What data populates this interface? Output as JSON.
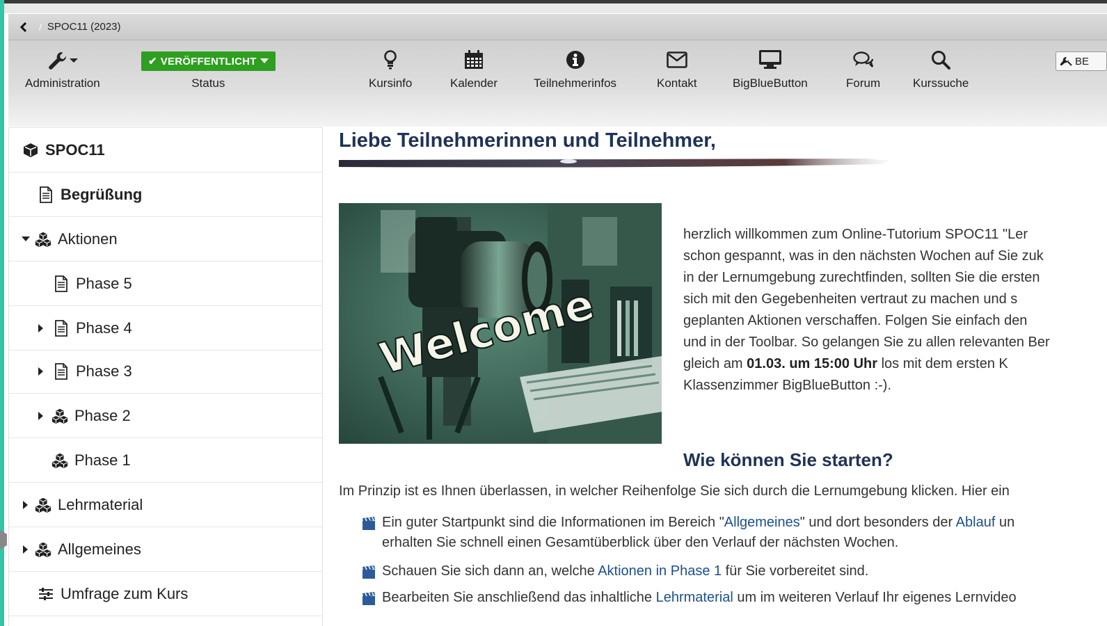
{
  "breadcrumb": {
    "back_label": "<",
    "course": "SPOC11 (2023)"
  },
  "toolbar": {
    "administration": "Administration",
    "status_badge": "VERÖFFENTLICHT",
    "status_label": "Status",
    "kursinfo": "Kursinfo",
    "kalender": "Kalender",
    "teilnehmerinfos": "Teilnehmerinfos",
    "kontakt": "Kontakt",
    "bigbluebutton": "BigBlueButton",
    "forum": "Forum",
    "kurssuche": "Kurssuche",
    "edit_label": "BE"
  },
  "sidebar": {
    "items": [
      {
        "label": "SPOC11",
        "icon": "cube-icon"
      },
      {
        "label": "Begrüßung",
        "icon": "document-icon"
      },
      {
        "label": "Aktionen",
        "icon": "cubes-icon",
        "expanded": true
      },
      {
        "label": "Phase 5",
        "icon": "document-icon"
      },
      {
        "label": "Phase 4",
        "icon": "document-icon"
      },
      {
        "label": "Phase 3",
        "icon": "document-icon"
      },
      {
        "label": "Phase 2",
        "icon": "cubes-icon"
      },
      {
        "label": "Phase 1",
        "icon": "cubes-icon"
      },
      {
        "label": "Lehrmaterial",
        "icon": "cubes-icon"
      },
      {
        "label": "Allgemeines",
        "icon": "cubes-icon"
      },
      {
        "label": "Umfrage zum Kurs",
        "icon": "survey-icon"
      }
    ]
  },
  "main": {
    "title": "Liebe Teilnehmerinnen und Teilnehmer,",
    "image_text": "Welcome",
    "intro_lines": [
      "herzlich willkommen zum Online-Tutorium SPOC11 \"Ler",
      "schon gespannt, was in den nächsten Wochen auf Sie zuk",
      "in der Lernumgebung zurechtfinden, sollten Sie die ersten",
      "sich mit den Gegebenheiten vertraut zu machen und s",
      "geplanten Aktionen verschaffen. Folgen Sie einfach den",
      "und in der Toolbar. So gelangen Sie zu allen relevanten Ber"
    ],
    "intro_line7_pre": "gleich am ",
    "intro_line7_date": "01.03. um 15:00 Uhr",
    "intro_line7_post": " los mit dem ersten K",
    "intro_line8": "Klassenzimmer BigBlueButton :-).",
    "subheading": "Wie können Sie starten?",
    "paragraph": "Im Prinzip ist es Ihnen überlassen, in welcher Reihenfolge Sie sich durch die Lernumgebung klicken. Hier ein",
    "bullet1_a": "Ein guter Startpunkt sind die Informationen im Bereich \"",
    "bullet1_link1": "Allgemeines",
    "bullet1_b": "\" und dort besonders der ",
    "bullet1_link2": "Ablauf",
    "bullet1_c": " un",
    "bullet1_line2": "erhalten Sie schnell einen Gesamtüberblick über den Verlauf der nächsten Wochen.",
    "bullet2_a": "Schauen Sie sich dann an, welche ",
    "bullet2_link": "Aktionen in Phase 1",
    "bullet2_b": " für Sie vorbereitet sind.",
    "bullet3_a": "Bearbeiten Sie anschließend das inhaltliche ",
    "bullet3_link": "Lehrmaterial",
    "bullet3_b": " um im weiteren Verlauf Ihr eigenes Lernvideo"
  },
  "colors": {
    "status_green": "#2e9f1f",
    "heading_navy": "#1f3256",
    "link_blue": "#1c4f8c",
    "frame_teal": "#2fc7a8"
  }
}
